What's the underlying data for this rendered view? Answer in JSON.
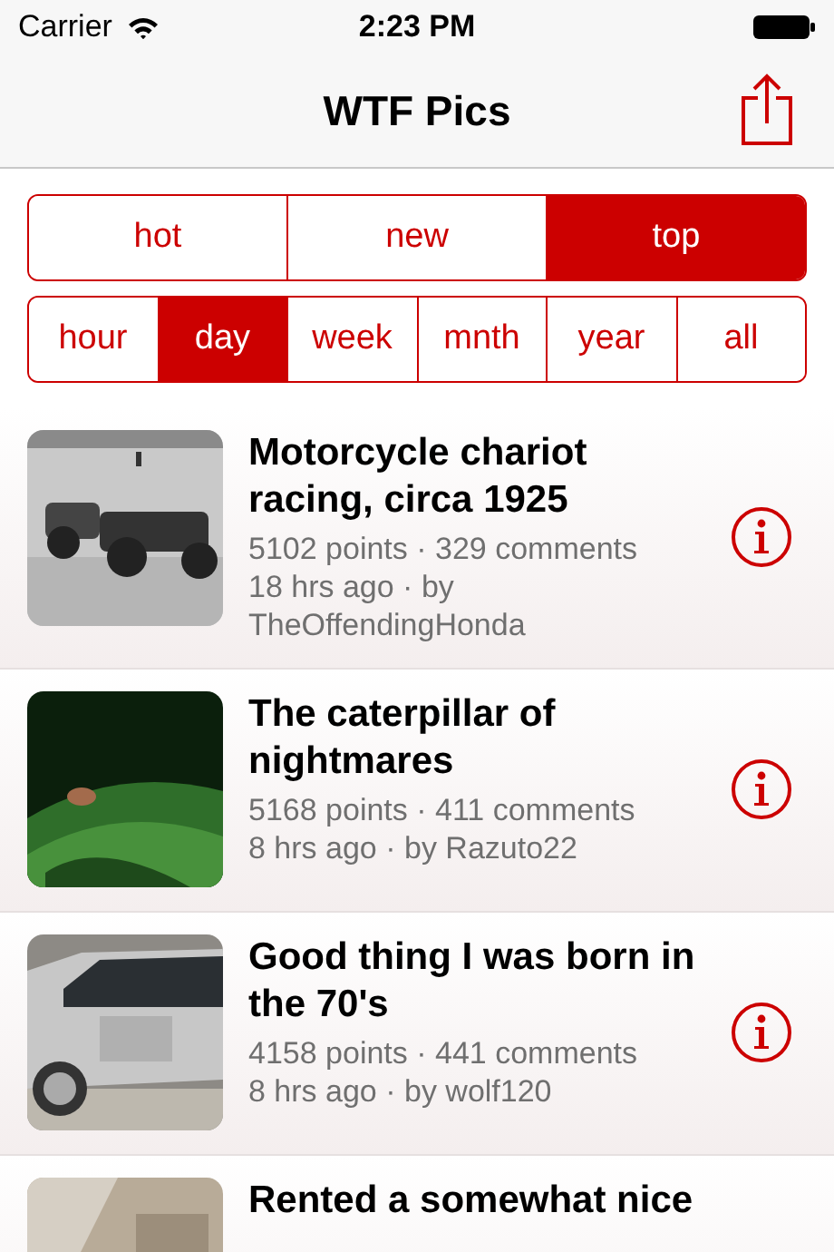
{
  "status_bar": {
    "carrier": "Carrier",
    "time": "2:23 PM"
  },
  "nav_bar": {
    "title": "WTF Pics"
  },
  "sort_tabs": [
    {
      "label": "hot",
      "selected": false
    },
    {
      "label": "new",
      "selected": false
    },
    {
      "label": "top",
      "selected": true
    }
  ],
  "period_tabs": [
    {
      "label": "hour",
      "selected": false
    },
    {
      "label": "day",
      "selected": true
    },
    {
      "label": "week",
      "selected": false
    },
    {
      "label": "mnth",
      "selected": false
    },
    {
      "label": "year",
      "selected": false
    },
    {
      "label": "all",
      "selected": false
    }
  ],
  "posts": [
    {
      "title": "Motorcycle chariot racing, circa 1925",
      "stats": "5102 points · 329 comments",
      "byline": "18 hrs ago · by TheOffendingHonda"
    },
    {
      "title": "The caterpillar of nightmares",
      "stats": "5168 points · 411 comments",
      "byline": "8 hrs ago · by Razuto22"
    },
    {
      "title": "Good thing I was born in the 70's",
      "stats": "4158 points · 441 comments",
      "byline": "8 hrs ago · by wolf120"
    },
    {
      "title": "Rented a somewhat nice"
    }
  ]
}
